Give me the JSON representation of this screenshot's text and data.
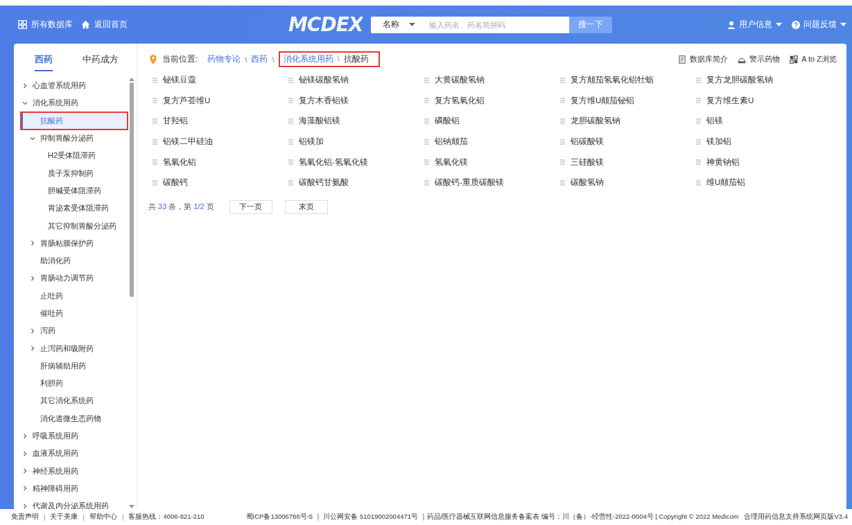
{
  "header": {
    "nav": [
      {
        "kind": "grid",
        "label": "所有数据库"
      },
      {
        "kind": "home",
        "label": "返回首页"
      }
    ],
    "logo": "MCDEX",
    "search": {
      "field_select": "名称",
      "placeholder": "输入药名、药名简拼码",
      "button": "搜一下"
    },
    "menus": [
      {
        "kind": "user",
        "label": "用户信息"
      },
      {
        "kind": "help",
        "label": "问题反馈"
      }
    ]
  },
  "sidebar": {
    "tabs": [
      {
        "label": "西药",
        "selected": true
      },
      {
        "label": "中药成方",
        "selected": false
      }
    ],
    "tree": [
      {
        "label": "心血管系统用药",
        "expanded": false,
        "selected": false,
        "highlighted": false
      },
      {
        "label": "消化系统用药",
        "expanded": true,
        "selected": false,
        "highlighted": false,
        "children": [
          {
            "label": "抗酸药",
            "selected": true,
            "highlighted": true
          },
          {
            "label": "抑制胃酸分泌药",
            "expanded": true,
            "selected": false,
            "highlighted": false,
            "children": [
              {
                "label": "H2受体阻滞药",
                "selected": false,
                "highlighted": false
              },
              {
                "label": "质子泵抑制药",
                "selected": false,
                "highlighted": false
              },
              {
                "label": "胆碱受体阻滞药",
                "selected": false,
                "highlighted": false
              },
              {
                "label": "胃泌素受体阻滞药",
                "selected": false,
                "highlighted": false
              },
              {
                "label": "其它抑制胃酸分泌药",
                "selected": false,
                "highlighted": false
              }
            ]
          },
          {
            "label": "胃肠粘膜保护药",
            "expanded": false,
            "selected": false,
            "highlighted": false
          },
          {
            "label": "助消化药",
            "selected": false,
            "highlighted": false
          },
          {
            "label": "胃肠动力调节药",
            "expanded": false,
            "selected": false,
            "highlighted": false
          },
          {
            "label": "止吐药",
            "selected": false,
            "highlighted": false
          },
          {
            "label": "催吐药",
            "selected": false,
            "highlighted": false
          },
          {
            "label": "泻药",
            "expanded": false,
            "selected": false,
            "highlighted": false
          },
          {
            "label": "止泻药和吸附药",
            "expanded": false,
            "selected": false,
            "highlighted": false
          },
          {
            "label": "肝病辅助用药",
            "selected": false,
            "highlighted": false
          },
          {
            "label": "利胆药",
            "selected": false,
            "highlighted": false
          },
          {
            "label": "其它消化系统药",
            "selected": false,
            "highlighted": false
          },
          {
            "label": "消化道微生态药物",
            "selected": false,
            "highlighted": false
          }
        ]
      },
      {
        "label": "呼吸系统用药",
        "expanded": false,
        "selected": false,
        "highlighted": false
      },
      {
        "label": "血液系统用药",
        "expanded": false,
        "selected": false,
        "highlighted": false
      },
      {
        "label": "神经系统用药",
        "expanded": false,
        "selected": false,
        "highlighted": false
      },
      {
        "label": "精神障碍用药",
        "expanded": false,
        "selected": false,
        "highlighted": false
      },
      {
        "label": "代谢及内分泌系统用药",
        "expanded": false,
        "selected": false,
        "highlighted": false
      }
    ]
  },
  "breadcrumb": {
    "label": "当前位置:",
    "separator": "\\",
    "items": [
      {
        "label": "药物专论",
        "highlighted": false
      },
      {
        "label": "西药",
        "highlighted": false
      },
      {
        "label": "消化系统用药",
        "highlighted": true
      },
      {
        "label": "抗酸药",
        "highlighted": true
      }
    ]
  },
  "tools": [
    {
      "kind": "doc",
      "label": "数据库简介"
    },
    {
      "kind": "warn",
      "label": "警示药物"
    },
    {
      "kind": "grid",
      "label": "A to Z浏览"
    }
  ],
  "drugs": [
    "铋镁豆蔻",
    "铋镁碳酸氢钠",
    "大黄碳酸氢钠",
    "复方颠茄氢氧化铝牡蛎",
    "复方龙胆碳酸氢钠",
    "复方芦荟维U",
    "复方木香铝镁",
    "复方氢氧化铝",
    "复方维U颠茄铋铝",
    "复方维生素U",
    "甘羟铝",
    "海藻酸铝镁",
    "磷酸铝",
    "龙胆碳酸氢钠",
    "铝镁",
    "铝镁二甲硅油",
    "铝镁加",
    "铝钠颠茄",
    "铝碳酸镁",
    "镁加铝",
    "氢氧化铝",
    "氢氧化铝-氢氧化镁",
    "氢氧化镁",
    "三硅酸镁",
    "神黄钠铝",
    "碳酸钙",
    "碳酸钙甘氨酸",
    "碳酸钙-重质碳酸镁",
    "碳酸氢钠",
    "维U颠茄铝"
  ],
  "pagination": {
    "prefix": "共",
    "total": "33",
    "middle": "条，第",
    "page": "1/2",
    "suffix": "页",
    "buttons": [
      "下一页",
      "末页"
    ]
  },
  "footer": {
    "separator": "|",
    "links": [
      "免责声明",
      "关于美康",
      "帮助中心"
    ],
    "hotline": "客服热线：4006-821-210",
    "legal": "蜀ICP备13006786号-5 ｜ 川公网安备 51019002004471号 ｜药品/医疗器械互联网信息服务备案表 编号：川（备）-经营性-2022-0004号 | Copyright © 2022 Medicom",
    "version": "合理用药信息支持系统网页版V3.4"
  }
}
